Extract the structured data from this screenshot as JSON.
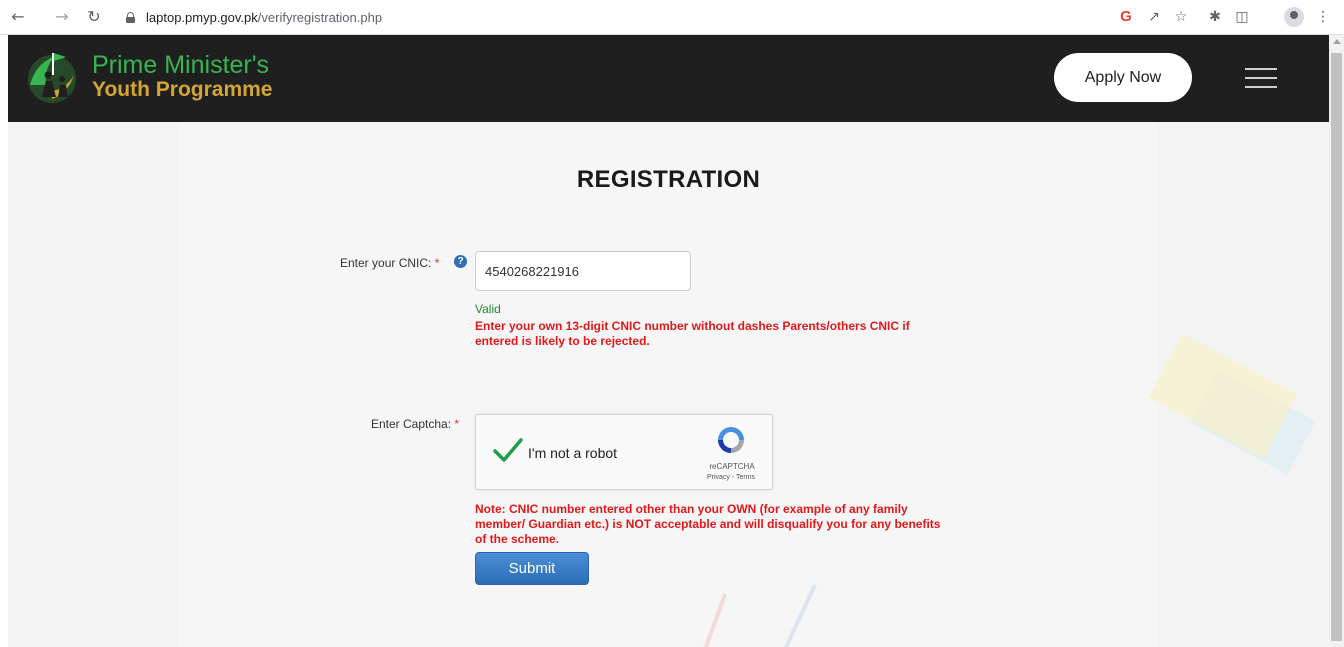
{
  "browser": {
    "url_host": "laptop.pmyp.gov.pk",
    "url_path": "/verifyregistration.php",
    "back_icon": "arrow-left-icon",
    "forward_icon": "arrow-right-icon",
    "reload_icon": "reload-icon",
    "g_label": "G"
  },
  "header": {
    "logo_line1": "Prime Minister's",
    "logo_line2": "Youth Programme",
    "apply_label": "Apply Now",
    "colors": {
      "background": "#1f1f1f",
      "green": "#36b552",
      "gold": "#d4a534"
    }
  },
  "main": {
    "title": "REGISTRATION",
    "cnic_label": "Enter your CNIC:",
    "required_mark": "*",
    "help_glyph": "?",
    "cnic_value": "4540268221916",
    "valid_text": "Valid",
    "cnic_warning_line1": "Enter your own 13-digit CNIC number without dashes Parents/others CNIC if",
    "cnic_warning_line2": "entered is likely to be rejected.",
    "captcha_label": "Enter Captcha:",
    "recaptcha": {
      "label": "I'm not a robot",
      "brand": "reCAPTCHA",
      "links": "Privacy - Terms",
      "checked": true
    },
    "note_line1": "Note: CNIC number entered other than your OWN (for example of any family",
    "note_line2": "member/ Guardian etc.) is NOT acceptable and will disqualify you for any benefits",
    "note_line3": "of the scheme.",
    "submit_label": "Submit",
    "colors": {
      "valid": "#1f8a2e",
      "warning": "#e0191b",
      "button": "#2b6db6"
    }
  }
}
